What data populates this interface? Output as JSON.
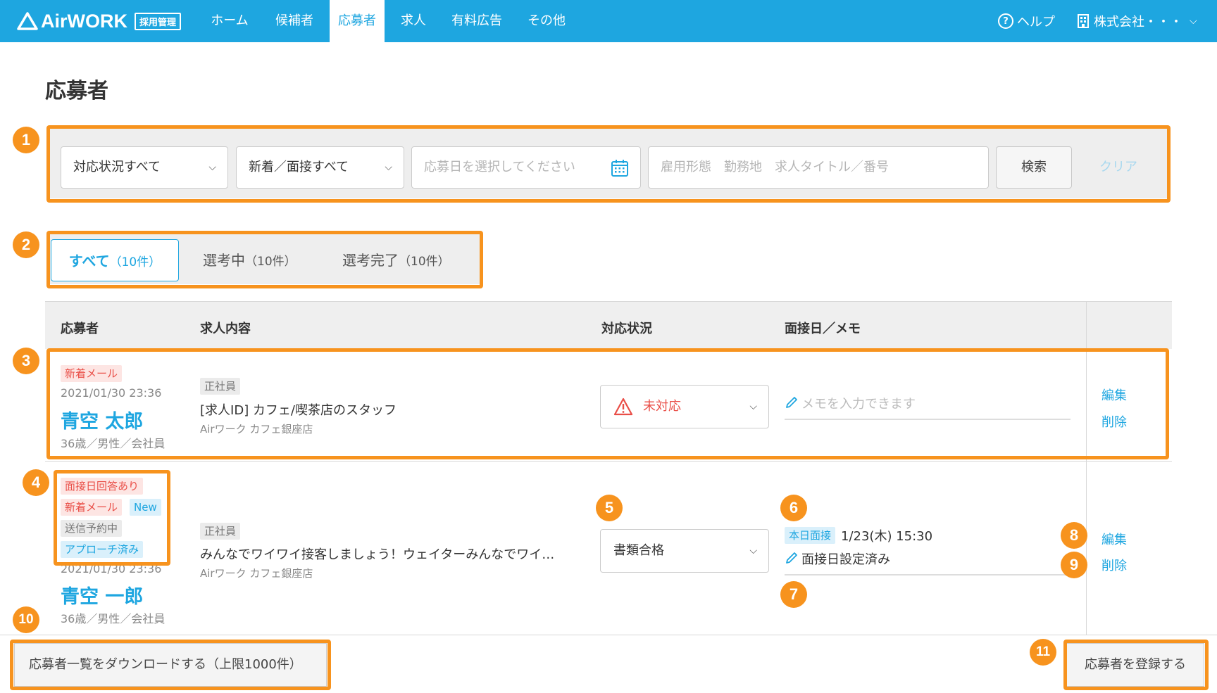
{
  "header": {
    "logo_text": "AirWORK",
    "logo_badge": "採用管理",
    "nav": [
      {
        "label": "ホーム"
      },
      {
        "label": "候補者"
      },
      {
        "label": "応募者",
        "active": true
      },
      {
        "label": "求人"
      },
      {
        "label": "有料広告"
      },
      {
        "label": "その他"
      }
    ],
    "help_label": "ヘルプ",
    "company_label": "株式会社・・・",
    "brand_color": "#1ea6e0"
  },
  "page_title": "応募者",
  "filter": {
    "status_select": "対応状況すべて",
    "new_interview_select": "新着／面接すべて",
    "date_placeholder": "応募日を選択してください",
    "keyword_placeholder": "雇用形態　勤務地　求人タイトル／番号",
    "search_label": "検索",
    "clear_label": "クリア"
  },
  "tabs": [
    {
      "label": "すべて",
      "count": "（10件）",
      "active": true
    },
    {
      "label": "選考中",
      "count": "（10件）"
    },
    {
      "label": "選考完了",
      "count": "（10件）"
    }
  ],
  "table": {
    "headers": [
      "応募者",
      "求人内容",
      "対応状況",
      "面接日／メモ"
    ],
    "rows": [
      {
        "tags": [
          "新着メール"
        ],
        "date": "2021/01/30 23:36",
        "name": "青空 太郎",
        "meta": "36歳／男性／会社員",
        "employment": "正社員",
        "job_title": "[求人ID] カフェ/喫茶店のスタッフ",
        "shop": "Airワーク カフェ銀座店",
        "status": "未対応",
        "memo_placeholder": "メモを入力できます",
        "edit": "編集",
        "delete": "削除"
      },
      {
        "tags": [
          "面接日回答あり",
          "新着メール",
          "New",
          "送信予約中",
          "アプローチ済み"
        ],
        "date": "2021/01/30 23:36",
        "name": "青空 一郎",
        "meta": "36歳／男性／会社員",
        "employment": "正社員",
        "job_title": "みんなでワイワイ接客しましょう！ウェイターみんなでワイ…",
        "shop": "Airワーク カフェ銀座店",
        "status": "書類合格",
        "interview_badge": "本日面接",
        "interview_datetime": "1/23(木) 15:30",
        "memo": "面接日設定済み",
        "edit": "編集",
        "delete": "削除"
      }
    ]
  },
  "footer": {
    "download_label": "応募者一覧をダウンロードする（上限1000件）",
    "register_label": "応募者を登録する"
  },
  "markers": [
    "1",
    "2",
    "3",
    "4",
    "5",
    "6",
    "7",
    "8",
    "9",
    "10",
    "11"
  ],
  "marker_color": "#f7931e"
}
